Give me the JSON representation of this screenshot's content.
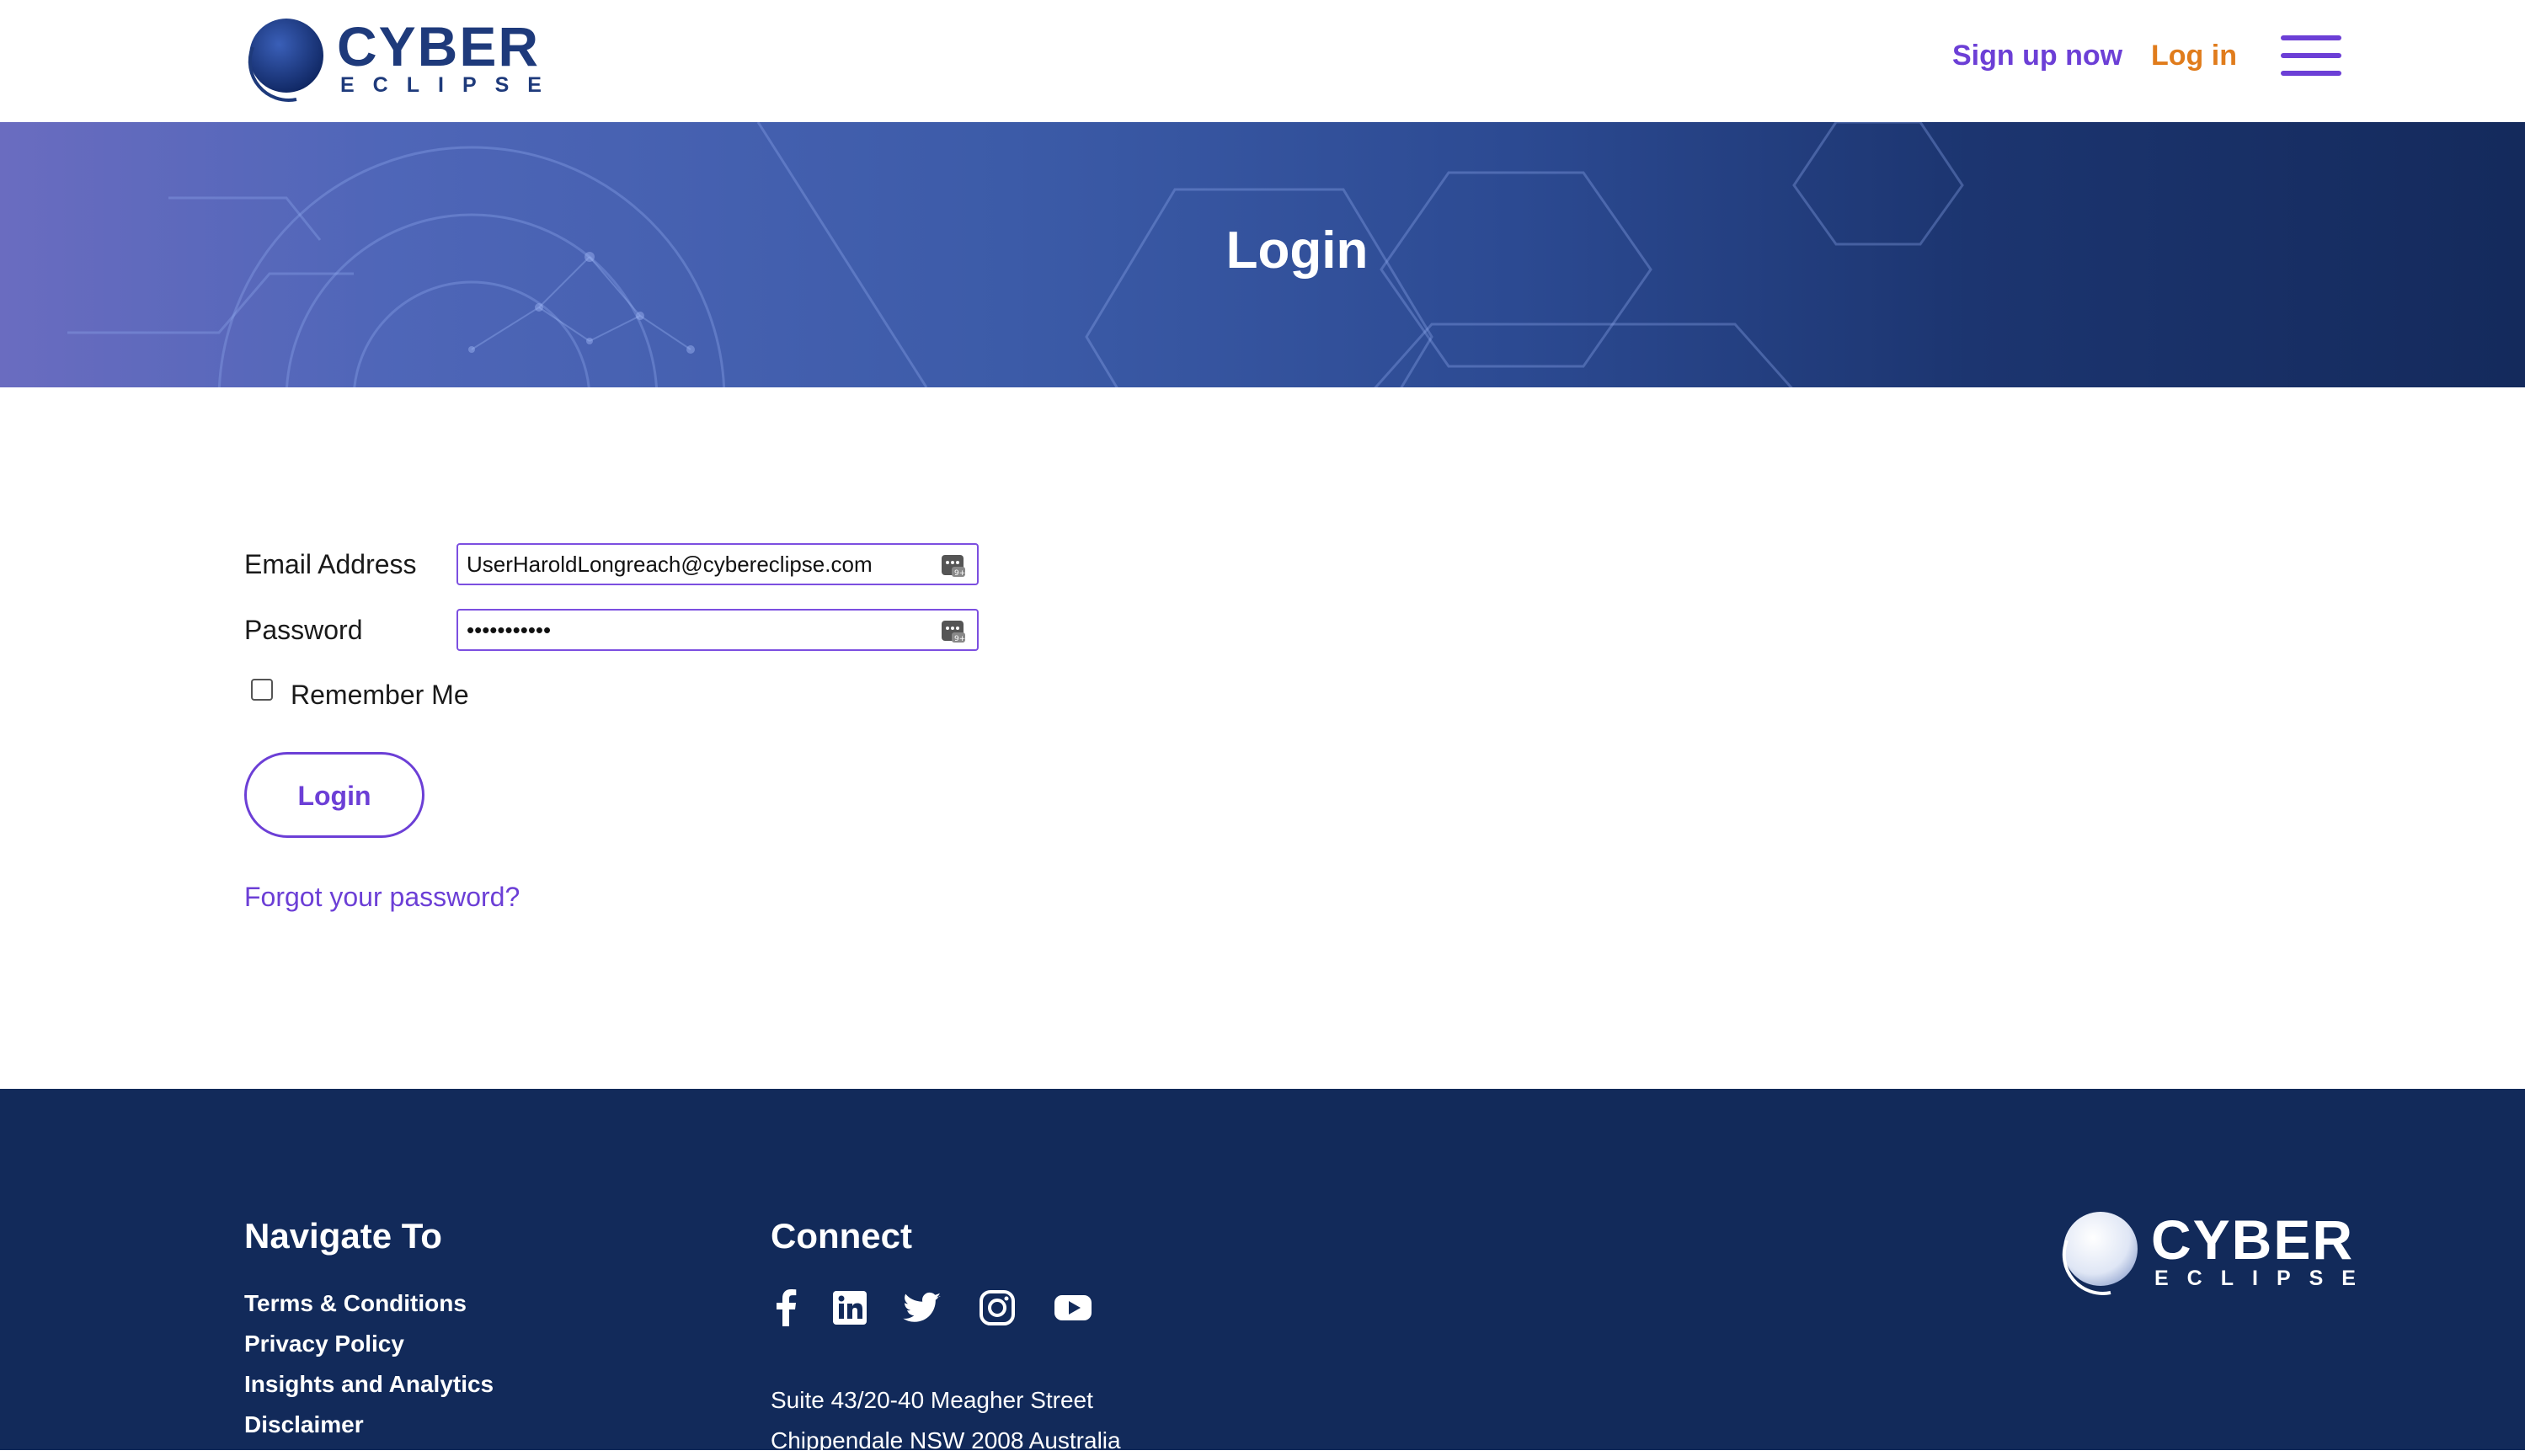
{
  "header": {
    "logo": {
      "word": "CYBER",
      "sub": "ECLIPSE"
    },
    "nav": {
      "signup_label": "Sign up now",
      "login_label": "Log in"
    }
  },
  "banner": {
    "title": "Login"
  },
  "form": {
    "email_label": "Email Address",
    "email_value": "UserHaroldLongreach@cybereclipse.com",
    "password_label": "Password",
    "password_value": "•••••••••••",
    "remember_label": "Remember Me",
    "remember_checked": false,
    "login_button": "Login",
    "forgot_link": "Forgot your password?"
  },
  "footer": {
    "navigate_heading": "Navigate To",
    "links": [
      "Terms & Conditions",
      "Privacy Policy",
      "Insights and Analytics",
      "Disclaimer"
    ],
    "connect_heading": "Connect",
    "social_icons": [
      "facebook-icon",
      "linkedin-icon",
      "twitter-icon",
      "instagram-icon",
      "youtube-icon"
    ],
    "address_line1": "Suite 43/20-40 Meagher Street",
    "address_line2": "Chippendale NSW 2008 Australia",
    "logo": {
      "word": "CYBER",
      "sub": "ECLIPSE"
    }
  },
  "colors": {
    "accent": "#6c3fd6",
    "login_link": "#e07c1c",
    "brand_navy": "#1e3a7b",
    "footer_bg": "#122a5a"
  }
}
